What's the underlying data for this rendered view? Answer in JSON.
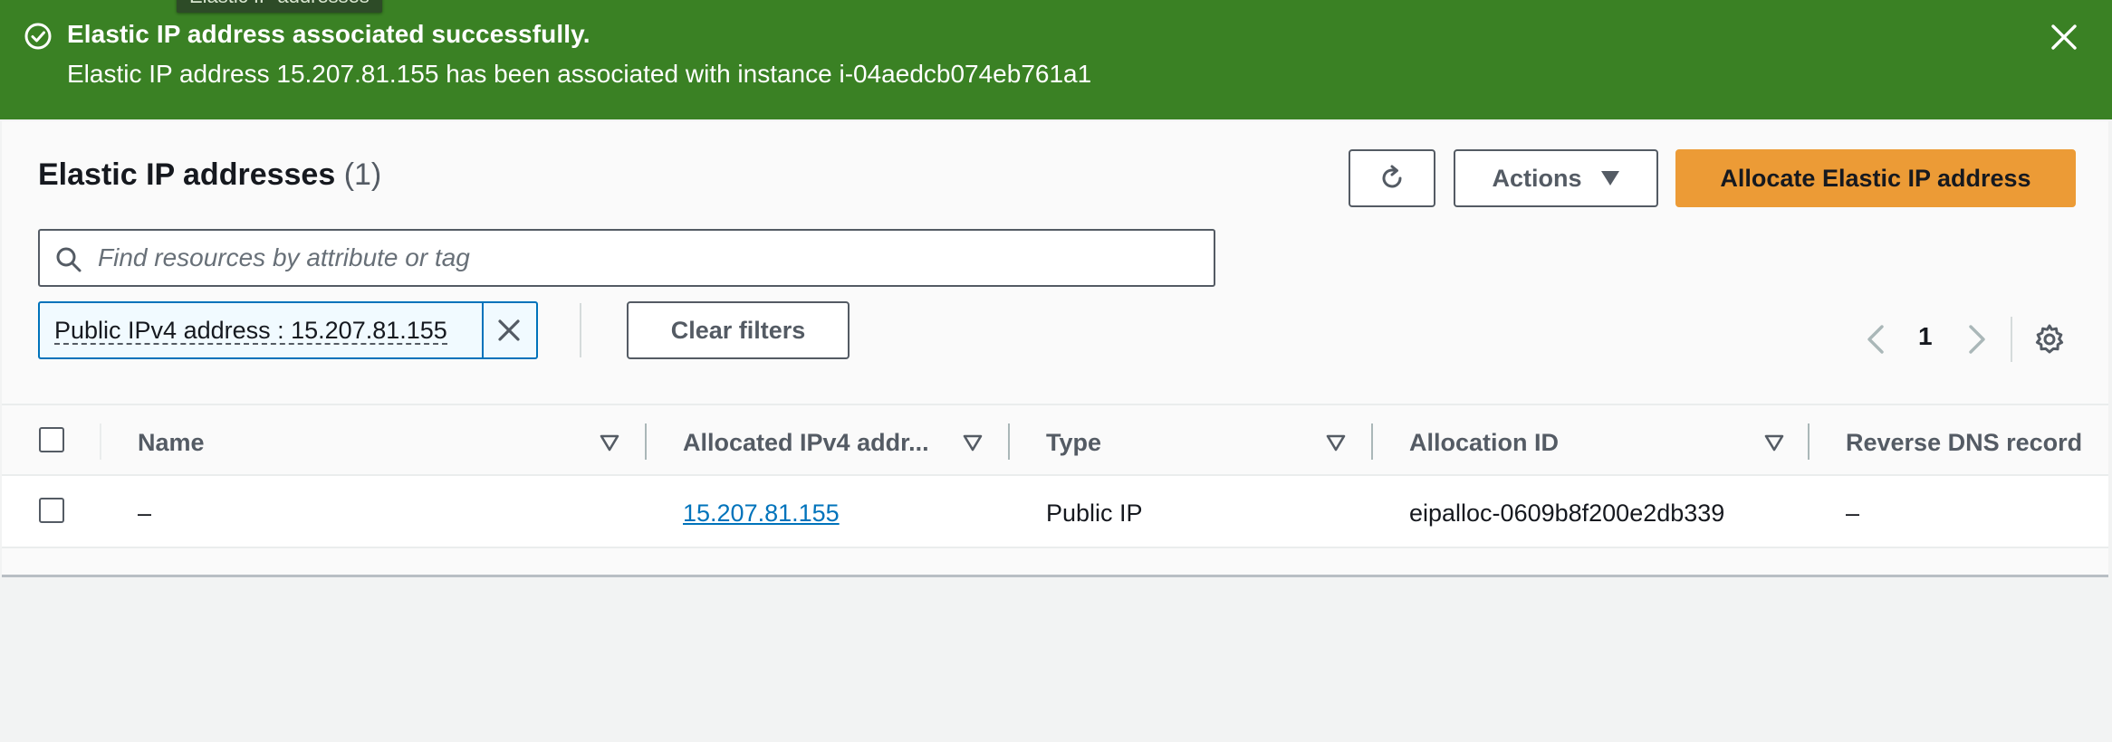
{
  "tooltip": {
    "text": "Elastic IP addresses"
  },
  "flash": {
    "title": "Elastic IP address associated successfully.",
    "message": "Elastic IP address 15.207.81.155 has been associated with instance i-04aedcb074eb761a1",
    "icon": "success-check-icon",
    "color": "#3a8124"
  },
  "header": {
    "title": "Elastic IP addresses",
    "count": "(1)",
    "actions_label": "Actions",
    "primary_label": "Allocate Elastic IP address",
    "primary_color": "#ec9b36"
  },
  "search": {
    "placeholder": "Find resources by attribute or tag",
    "value": ""
  },
  "filter_token": {
    "label": "Public IPv4 address : 15.207.81.155"
  },
  "clear_filters_label": "Clear filters",
  "pagination": {
    "current_page": "1"
  },
  "table": {
    "columns": [
      "Name",
      "Allocated IPv4 addr...",
      "Type",
      "Allocation ID",
      "Reverse DNS record"
    ],
    "rows": [
      {
        "name": "–",
        "ipv4": "15.207.81.155",
        "type": "Public IP",
        "allocation_id": "eipalloc-0609b8f200e2db339",
        "reverse_dns": "–"
      }
    ]
  }
}
